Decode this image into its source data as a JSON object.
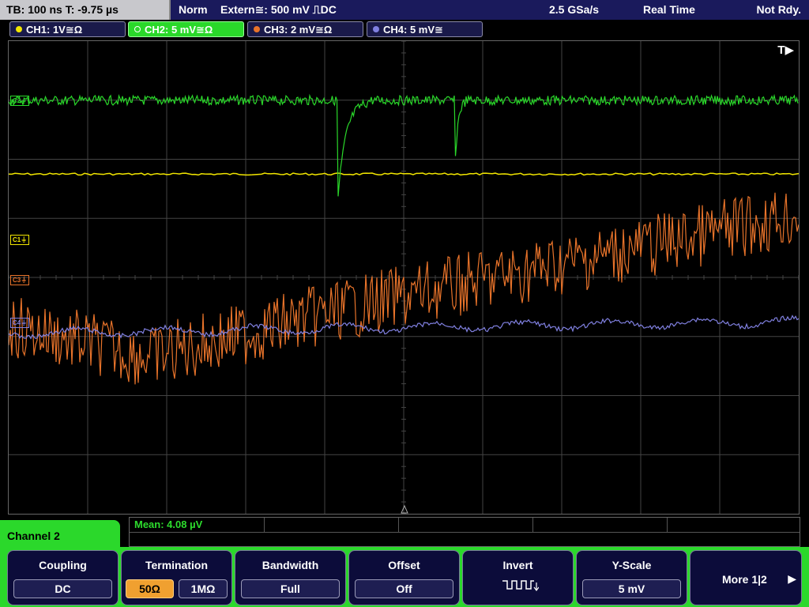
{
  "statusbar": {
    "timebase": "TB: 100 ns   T: -9.75 µs",
    "mode": "Norm",
    "trigger": "Extern≅: 500 mV ⎍DC",
    "sample_rate": "2.5 GSa/s",
    "acquisition": "Real Time",
    "state": "Not Rdy."
  },
  "channels": [
    {
      "label": "CH1: 1V≅Ω",
      "color": "#f2e600"
    },
    {
      "label": "CH2: 5 mV≅Ω",
      "color": "#2ad82a"
    },
    {
      "label": "CH3: 2 mV≅Ω",
      "color": "#e8732a"
    },
    {
      "label": "CH4: 5 mV≅",
      "color": "#8080e0"
    }
  ],
  "markers": {
    "ch1": "C1⏚",
    "ch2": "C2⏚",
    "ch3": "C3⏚",
    "ch4": "C4⏚",
    "trigger": "T▶"
  },
  "measurement": {
    "mean": "Mean: 4.08 µV"
  },
  "menu": {
    "title": "Channel 2",
    "softkeys": [
      {
        "title": "Coupling",
        "value": "DC"
      },
      {
        "title": "Termination",
        "options": [
          "50Ω",
          "1MΩ"
        ],
        "selected": "50Ω"
      },
      {
        "title": "Bandwidth",
        "value": "Full"
      },
      {
        "title": "Offset",
        "value": "Off"
      },
      {
        "title": "Invert",
        "icon": "invert-waveform-icon"
      },
      {
        "title": "Y-Scale",
        "value": "5 mV"
      }
    ],
    "more_label": "More 1|2"
  },
  "colors": {
    "accent": "#2bd82b",
    "ch1": "#f2e600",
    "ch2": "#2ad82a",
    "ch3": "#e8732a",
    "ch4": "#8080e0"
  }
}
